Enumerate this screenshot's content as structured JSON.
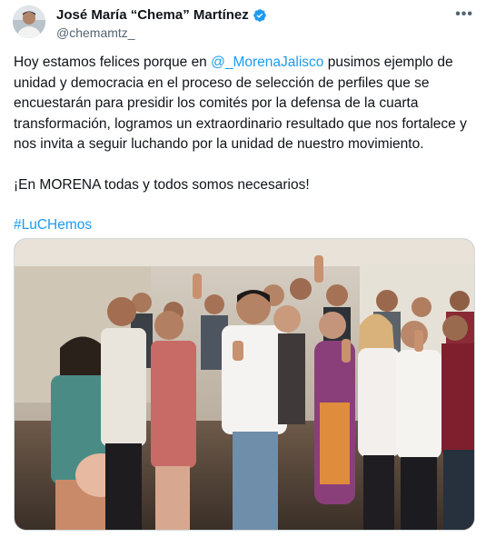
{
  "author": {
    "display_name": "José María “Chema” Martínez",
    "handle": "@chemamtz_",
    "verified": true,
    "avatar": "profile-photo"
  },
  "menu": {
    "icon": "more-horizontal-icon",
    "glyph": "•••"
  },
  "tweet": {
    "text_part1": "Hoy estamos felices porque en ",
    "mention": "@_MorenaJalisco",
    "text_part2": " pusimos ejemplo de unidad y democracia en el proceso de selección de perfiles que se encuestarán para presidir los comités por la defensa de la cuarta transformación, logramos un extraordinario resultado que nos fortalece y nos invita a seguir luchando por la unidad de nuestro movimiento.",
    "line2": "¡En MORENA todas y todos somos necesarios!",
    "hashtag": "#LuCHemos"
  },
  "media": {
    "kind": "photo",
    "subject": "group-photo"
  },
  "colors": {
    "link": "#1d9bf0",
    "verified": "#1d9bf0",
    "secondary_text": "#536471",
    "primary_text": "#0f1419"
  }
}
